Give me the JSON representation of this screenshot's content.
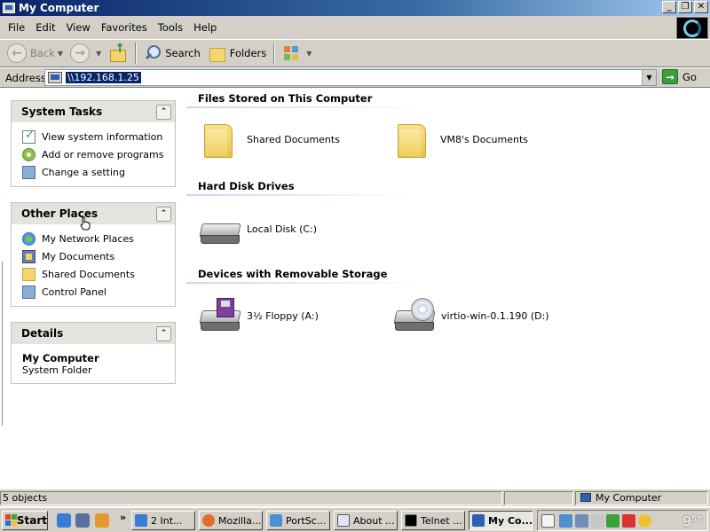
{
  "window": {
    "title": "My Computer",
    "minimize": "_",
    "restore": "❐",
    "close": "✕"
  },
  "menu": [
    "File",
    "Edit",
    "View",
    "Favorites",
    "Tools",
    "Help"
  ],
  "toolbar": {
    "back": "Back",
    "search": "Search",
    "folders": "Folders"
  },
  "address": {
    "label": "Address",
    "value": "\\\\192.168.1.25",
    "go": "Go"
  },
  "system_tasks": {
    "title": "System Tasks",
    "items": [
      "View system information",
      "Add or remove programs",
      "Change a setting"
    ]
  },
  "other_places": {
    "title": "Other Places",
    "items": [
      "My Network Places",
      "My Documents",
      "Shared Documents",
      "Control Panel"
    ]
  },
  "details": {
    "title": "Details",
    "name": "My Computer",
    "type": "System Folder"
  },
  "sections": {
    "files": {
      "title": "Files Stored on This Computer",
      "items": [
        "Shared Documents",
        "VM8's Documents"
      ]
    },
    "disks": {
      "title": "Hard Disk Drives",
      "items": [
        "Local Disk (C:)"
      ]
    },
    "removable": {
      "title": "Devices with Removable Storage",
      "items": [
        "3½ Floppy (A:)",
        "virtio-win-0.1.190 (D:)"
      ]
    }
  },
  "status": {
    "objects": "5 objects",
    "location": "My Computer"
  },
  "taskbar": {
    "start": "Start",
    "overflow": "»",
    "tasks": [
      "2 Int...",
      "Mozilla...",
      "PortSc...",
      "About ...",
      "Telnet ...",
      "My Co..."
    ],
    "clock": "9⁵⁸"
  }
}
